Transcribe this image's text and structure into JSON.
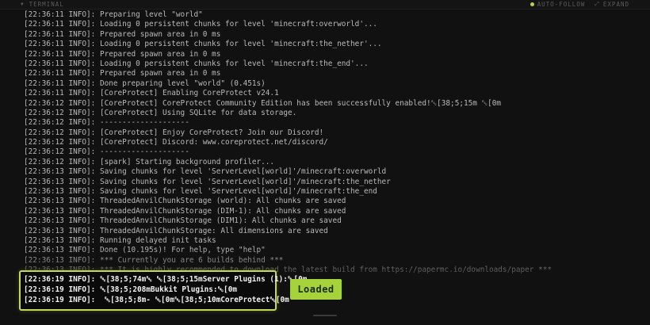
{
  "header": {
    "title": "TERMINAL",
    "auto_follow": "AUTO-FOLLOW",
    "expand": "EXPAND"
  },
  "log_lines": [
    "[22:36:11 INFO]: Preparing level \"world\"",
    "[22:36:11 INFO]: Loading 0 persistent chunks for level 'minecraft:overworld'...",
    "[22:36:11 INFO]: Prepared spawn area in 0 ms",
    "[22:36:11 INFO]: Loading 0 persistent chunks for level 'minecraft:the_nether'...",
    "[22:36:11 INFO]: Prepared spawn area in 0 ms",
    "[22:36:11 INFO]: Loading 0 persistent chunks for level 'minecraft:the_end'...",
    "[22:36:11 INFO]: Prepared spawn area in 0 ms",
    "[22:36:11 INFO]: Done preparing level \"world\" (0.451s)",
    "[22:36:11 INFO]: [CoreProtect] Enabling CoreProtect v24.1",
    "[22:36:12 INFO]: [CoreProtect] CoreProtect Community Edition has been successfully enabled!␛[38;5;15m ␛[0m",
    "[22:36:12 INFO]: [CoreProtect] Using SQLite for data storage.",
    "[22:36:12 INFO]: --------------------",
    "[22:36:12 INFO]: [CoreProtect] Enjoy CoreProtect? Join our Discord!",
    "[22:36:12 INFO]: [CoreProtect] Discord: www.coreprotect.net/discord/",
    "[22:36:12 INFO]: --------------------",
    "[22:36:12 INFO]: [spark] Starting background profiler...",
    "[22:36:13 INFO]: Saving chunks for level 'ServerLevel[world]'/minecraft:overworld",
    "[22:36:13 INFO]: Saving chunks for level 'ServerLevel[world]'/minecraft:the_nether",
    "[22:36:13 INFO]: Saving chunks for level 'ServerLevel[world]'/minecraft:the_end",
    "[22:36:13 INFO]: ThreadedAnvilChunkStorage (world): All chunks are saved",
    "[22:36:13 INFO]: ThreadedAnvilChunkStorage (DIM-1): All chunks are saved",
    "[22:36:13 INFO]: ThreadedAnvilChunkStorage (DIM1): All chunks are saved",
    "[22:36:13 INFO]: ThreadedAnvilChunkStorage: All dimensions are saved",
    "[22:36:13 INFO]: Running delayed init tasks",
    "[22:36:13 INFO]: Done (10.195s)! For help, type \"help\"",
    "[22:36:13 INFO]: *** Currently you are 6 builds behind ***",
    "[22:36:13 INFO]: *** It is highly recommended to download the latest build from https://papermc.io/downloads/paper ***"
  ],
  "highlighted_lines": [
    "[22:36:19 INFO]: ␛[38;5;74m␛ ␛[38;5;15mServer Plugins (1):␛[0m",
    "[22:36:19 INFO]: ␛[38;5;208mBukkit Plugins:␛[0m",
    "[22:36:19 INFO]:  ␛[38;5;8m- ␛[0m␛[38;5;10mCoreProtect␛[0m"
  ],
  "status_badge": "Loaded",
  "colors": {
    "accent": "#c3d95a",
    "badge_bg": "#a6d23c",
    "auto_follow_dot": "#c0d044"
  }
}
